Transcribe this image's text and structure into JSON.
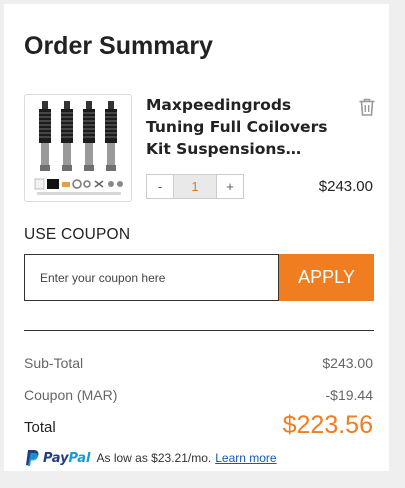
{
  "summary": {
    "title": "Order Summary"
  },
  "cart_item": {
    "image_alt": "Coilover suspension kit product photo",
    "name": "Maxpeedingrods Tuning Full Coilovers Kit Suspensions…",
    "quantity": "1",
    "decrement_label": "-",
    "increment_label": "+",
    "price": "$243.00"
  },
  "coupon": {
    "label": "USE COUPON",
    "placeholder": "Enter your coupon here",
    "value": "",
    "apply_label": "APPLY"
  },
  "totals": {
    "subtotal_label": "Sub-Total",
    "subtotal_value": "$243.00",
    "coupon_label": "Coupon (MAR)",
    "coupon_value": "-$19.44",
    "total_label": "Total",
    "total_value": "$223.56"
  },
  "paypal": {
    "brand_part1": "Pay",
    "brand_part2": "Pal",
    "message": "As low as $23.21/mo.",
    "link_label": "Learn more"
  },
  "colors": {
    "accent": "#f07d1f",
    "link": "#1a56b8",
    "paypal_dark": "#253b80",
    "paypal_light": "#179bd7"
  },
  "icons": {
    "delete": "trash-icon",
    "paypal": "paypal-logo-icon"
  }
}
